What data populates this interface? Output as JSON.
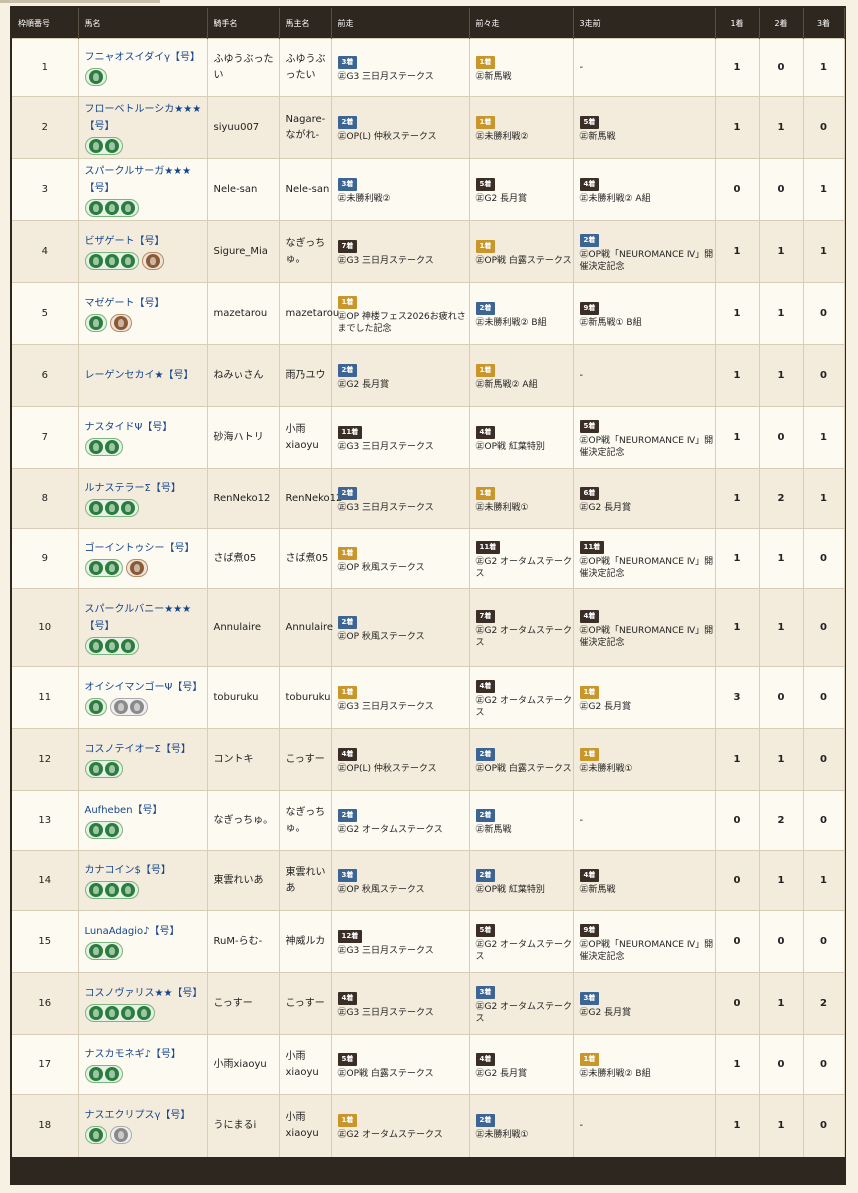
{
  "headers": {
    "no": "枠順番号",
    "horse": "馬名",
    "jockey": "騎手名",
    "owner": "馬主名",
    "race1": "前走",
    "race2": "前々走",
    "race3": "3走前",
    "p1": "1着",
    "p2": "2着",
    "p3": "3着"
  },
  "rows": [
    {
      "no": "1",
      "name": "フニャオスイダイγ【号】",
      "icons": [
        [
          "green"
        ]
      ],
      "jockey": "ふゆうぶったい",
      "owner": "ふゆうぶったい",
      "r1": {
        "badge": "3着",
        "color": "blue",
        "race": "㊣G3 三日月ステークス"
      },
      "r2": {
        "badge": "1着",
        "color": "gold",
        "race": "㊣新馬戦"
      },
      "r3": {
        "badge": "",
        "color": "",
        "race": "-"
      },
      "p1": "1",
      "p2": "0",
      "p3": "1"
    },
    {
      "no": "2",
      "name": "フローベトルーシカ★★★【号】",
      "icons": [
        [
          "green",
          "green"
        ]
      ],
      "jockey": "siyuu007",
      "owner": "Nagare-ながれ-",
      "r1": {
        "badge": "2着",
        "color": "blue",
        "race": "㊣OP(L) 仲秋ステークス"
      },
      "r2": {
        "badge": "1着",
        "color": "gold",
        "race": "㊣未勝利戦②"
      },
      "r3": {
        "badge": "5着",
        "color": "dark",
        "race": "㊣新馬戦"
      },
      "p1": "1",
      "p2": "1",
      "p3": "0"
    },
    {
      "no": "3",
      "name": "スパークルサーガ★★★【号】",
      "icons": [
        [
          "green",
          "green",
          "green"
        ]
      ],
      "jockey": "Nele-san",
      "owner": "Nele-san",
      "r1": {
        "badge": "3着",
        "color": "blue",
        "race": "㊣未勝利戦②"
      },
      "r2": {
        "badge": "5着",
        "color": "dark",
        "race": "㊣G2 長月賞"
      },
      "r3": {
        "badge": "4着",
        "color": "dark",
        "race": "㊣未勝利戦② A組"
      },
      "p1": "0",
      "p2": "0",
      "p3": "1"
    },
    {
      "no": "4",
      "name": "ビザゲート【号】",
      "icons": [
        [
          "green",
          "green",
          "green"
        ],
        [
          "brown"
        ]
      ],
      "jockey": "Sigure_Mia",
      "owner": "なぎっちゅ。",
      "r1": {
        "badge": "7着",
        "color": "dark",
        "race": "㊣G3 三日月ステークス"
      },
      "r2": {
        "badge": "1着",
        "color": "gold",
        "race": "㊣OP戦 白露ステークス"
      },
      "r3": {
        "badge": "2着",
        "color": "blue",
        "race": "㊣OP戦「NEUROMANCE Ⅳ」開催決定記念"
      },
      "p1": "1",
      "p2": "1",
      "p3": "1"
    },
    {
      "no": "5",
      "name": "マゼゲート【号】",
      "icons": [
        [
          "green"
        ],
        [
          "brown"
        ]
      ],
      "jockey": "mazetarou",
      "owner": "mazetarou",
      "r1": {
        "badge": "1着",
        "color": "gold",
        "race": "㊣OP 神楼フェス2026お疲れさまでした記念"
      },
      "r2": {
        "badge": "2着",
        "color": "blue",
        "race": "㊣未勝利戦② B組"
      },
      "r3": {
        "badge": "9着",
        "color": "dark",
        "race": "㊣新馬戦① B組"
      },
      "p1": "1",
      "p2": "1",
      "p3": "0"
    },
    {
      "no": "6",
      "name": "レーゲンセカイ★【号】",
      "icons": [],
      "jockey": "ねみぃさん",
      "owner": "雨乃ユウ",
      "r1": {
        "badge": "2着",
        "color": "blue",
        "race": "㊣G2 長月賞"
      },
      "r2": {
        "badge": "1着",
        "color": "gold",
        "race": "㊣新馬戦② A組"
      },
      "r3": {
        "badge": "",
        "color": "",
        "race": "-"
      },
      "p1": "1",
      "p2": "1",
      "p3": "0"
    },
    {
      "no": "7",
      "name": "ナスタイドΨ【号】",
      "icons": [
        [
          "green",
          "green"
        ]
      ],
      "jockey": "砂海ハトリ",
      "owner": "小雨xiaoyu",
      "r1": {
        "badge": "11着",
        "color": "dark",
        "race": "㊣G3 三日月ステークス"
      },
      "r2": {
        "badge": "4着",
        "color": "dark",
        "race": "㊣OP戦 紅葉特別"
      },
      "r3": {
        "badge": "5着",
        "color": "dark",
        "race": "㊣OP戦「NEUROMANCE Ⅳ」開催決定記念"
      },
      "p1": "1",
      "p2": "0",
      "p3": "1"
    },
    {
      "no": "8",
      "name": "ルナステラーΣ【号】",
      "icons": [
        [
          "green",
          "green",
          "green"
        ]
      ],
      "jockey": "RenNeko12",
      "owner": "RenNeko12",
      "r1": {
        "badge": "2着",
        "color": "blue",
        "race": "㊣G3 三日月ステークス"
      },
      "r2": {
        "badge": "1着",
        "color": "gold",
        "race": "㊣未勝利戦①"
      },
      "r3": {
        "badge": "6着",
        "color": "dark",
        "race": "㊣G2 長月賞"
      },
      "p1": "1",
      "p2": "2",
      "p3": "1"
    },
    {
      "no": "9",
      "name": "ゴーイントゥシー【号】",
      "icons": [
        [
          "green",
          "green"
        ],
        [
          "brown"
        ]
      ],
      "jockey": "さば煮05",
      "owner": "さば煮05",
      "r1": {
        "badge": "1着",
        "color": "gold",
        "race": "㊣OP 秋風ステークス"
      },
      "r2": {
        "badge": "11着",
        "color": "dark",
        "race": "㊣G2 オータムステークス"
      },
      "r3": {
        "badge": "11着",
        "color": "dark",
        "race": "㊣OP戦「NEUROMANCE Ⅳ」開催決定記念"
      },
      "p1": "1",
      "p2": "1",
      "p3": "0"
    },
    {
      "no": "10",
      "name": "スパークルバニー★★★【号】",
      "icons": [
        [
          "green",
          "green",
          "green"
        ]
      ],
      "jockey": "Annulaire",
      "owner": "Annulaire",
      "r1": {
        "badge": "2着",
        "color": "blue",
        "race": "㊣OP 秋風ステークス"
      },
      "r2": {
        "badge": "7着",
        "color": "dark",
        "race": "㊣G2 オータムステークス"
      },
      "r3": {
        "badge": "4着",
        "color": "dark",
        "race": "㊣OP戦「NEUROMANCE Ⅳ」開催決定記念"
      },
      "p1": "1",
      "p2": "1",
      "p3": "0"
    },
    {
      "no": "11",
      "name": "オイシイマンゴーΨ【号】",
      "icons": [
        [
          "green"
        ],
        [
          "silver",
          "silver"
        ]
      ],
      "jockey": "toburuku",
      "owner": "toburuku",
      "r1": {
        "badge": "1着",
        "color": "gold",
        "race": "㊣G3 三日月ステークス"
      },
      "r2": {
        "badge": "4着",
        "color": "dark",
        "race": "㊣G2 オータムステークス"
      },
      "r3": {
        "badge": "1着",
        "color": "gold",
        "race": "㊣G2 長月賞"
      },
      "p1": "3",
      "p2": "0",
      "p3": "0"
    },
    {
      "no": "12",
      "name": "コスノテイオーΣ【号】",
      "icons": [
        [
          "green",
          "green"
        ]
      ],
      "jockey": "コントキ",
      "owner": "こっすー",
      "r1": {
        "badge": "4着",
        "color": "dark",
        "race": "㊣OP(L) 仲秋ステークス"
      },
      "r2": {
        "badge": "2着",
        "color": "blue",
        "race": "㊣OP戦 白露ステークス"
      },
      "r3": {
        "badge": "1着",
        "color": "gold",
        "race": "㊣未勝利戦①"
      },
      "p1": "1",
      "p2": "1",
      "p3": "0"
    },
    {
      "no": "13",
      "name": "Aufheben【号】",
      "icons": [
        [
          "green",
          "green"
        ]
      ],
      "jockey": "なぎっちゅ。",
      "owner": "なぎっちゅ。",
      "r1": {
        "badge": "2着",
        "color": "blue",
        "race": "㊣G2 オータムステークス"
      },
      "r2": {
        "badge": "2着",
        "color": "blue",
        "race": "㊣新馬戦"
      },
      "r3": {
        "badge": "",
        "color": "",
        "race": "-"
      },
      "p1": "0",
      "p2": "2",
      "p3": "0"
    },
    {
      "no": "14",
      "name": "カナコイン$【号】",
      "icons": [
        [
          "green",
          "green",
          "green"
        ]
      ],
      "jockey": "東雲れいあ",
      "owner": "東雲れいあ",
      "r1": {
        "badge": "3着",
        "color": "blue",
        "race": "㊣OP 秋風ステークス"
      },
      "r2": {
        "badge": "2着",
        "color": "blue",
        "race": "㊣OP戦 紅葉特別"
      },
      "r3": {
        "badge": "4着",
        "color": "dark",
        "race": "㊣新馬戦"
      },
      "p1": "0",
      "p2": "1",
      "p3": "1"
    },
    {
      "no": "15",
      "name": "LunaAdagio♪【号】",
      "icons": [
        [
          "green",
          "green"
        ]
      ],
      "jockey": "RuM-らむ-",
      "owner": "神威ルカ",
      "r1": {
        "badge": "12着",
        "color": "dark",
        "race": "㊣G3 三日月ステークス"
      },
      "r2": {
        "badge": "5着",
        "color": "dark",
        "race": "㊣G2 オータムステークス"
      },
      "r3": {
        "badge": "9着",
        "color": "dark",
        "race": "㊣OP戦「NEUROMANCE Ⅳ」開催決定記念"
      },
      "p1": "0",
      "p2": "0",
      "p3": "0"
    },
    {
      "no": "16",
      "name": "コスノヴァリス★★【号】",
      "icons": [
        [
          "green",
          "green",
          "green",
          "green"
        ]
      ],
      "jockey": "こっすー",
      "owner": "こっすー",
      "r1": {
        "badge": "4着",
        "color": "dark",
        "race": "㊣G3 三日月ステークス"
      },
      "r2": {
        "badge": "3着",
        "color": "blue",
        "race": "㊣G2 オータムステークス"
      },
      "r3": {
        "badge": "3着",
        "color": "blue",
        "race": "㊣G2 長月賞"
      },
      "p1": "0",
      "p2": "1",
      "p3": "2"
    },
    {
      "no": "17",
      "name": "ナスカモネギ♪【号】",
      "icons": [
        [
          "green",
          "green"
        ]
      ],
      "jockey": "小雨xiaoyu",
      "owner": "小雨xiaoyu",
      "r1": {
        "badge": "5着",
        "color": "dark",
        "race": "㊣OP戦 白露ステークス"
      },
      "r2": {
        "badge": "4着",
        "color": "dark",
        "race": "㊣G2 長月賞"
      },
      "r3": {
        "badge": "1着",
        "color": "gold",
        "race": "㊣未勝利戦② B組"
      },
      "p1": "1",
      "p2": "0",
      "p3": "0"
    },
    {
      "no": "18",
      "name": "ナスエクリプスγ【号】",
      "icons": [
        [
          "green"
        ],
        [
          "silver"
        ]
      ],
      "jockey": "うにまるi",
      "owner": "小雨xiaoyu",
      "r1": {
        "badge": "1着",
        "color": "gold",
        "race": "㊣G2 オータムステークス"
      },
      "r2": {
        "badge": "2着",
        "color": "blue",
        "race": "㊣未勝利戦①"
      },
      "r3": {
        "badge": "",
        "color": "",
        "race": "-"
      },
      "p1": "1",
      "p2": "1",
      "p3": "0"
    }
  ],
  "colors": {
    "header_bg": "#2e2720",
    "row_odd": "#fdfaf2",
    "row_even": "#f3ebdb",
    "link": "#15468b",
    "gold_badge": "#c8962a",
    "blue_badge": "#3d6594",
    "dark_badge": "#3a2e26"
  }
}
